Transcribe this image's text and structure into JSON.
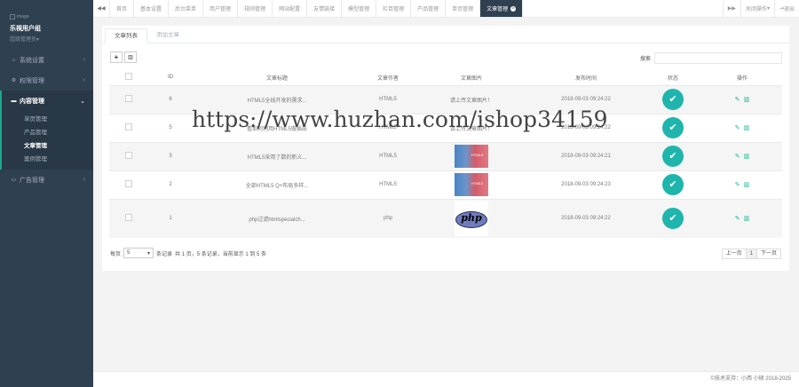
{
  "sidebar": {
    "avatar_alt": "image",
    "username": "乐視用户组",
    "role": "超级管理员",
    "role_caret": "▾",
    "nav": [
      {
        "label": "系统设置",
        "icon": "home-icon"
      },
      {
        "label": "权限管理",
        "icon": "gear-icon"
      },
      {
        "label": "内容管理",
        "icon": "folder-icon"
      },
      {
        "label": "广告管理",
        "icon": "monitor-icon"
      }
    ],
    "sub": [
      "单页管理",
      "产品管理",
      "文章管理",
      "案例管理"
    ]
  },
  "topbar": {
    "prev_arrow": "◀◀",
    "next_arrow": "▶▶",
    "tabs": [
      "首页",
      "基本设置",
      "后台菜单",
      "用户管理",
      "规则管理",
      "网站配置",
      "友情链接",
      "模型管理",
      "栏目管理",
      "产品管理",
      "单页管理",
      "文章管理"
    ],
    "close_ops": "关闭操作",
    "logout": "退出"
  },
  "panel": {
    "subtabs": [
      "文章列表",
      "添加文章"
    ],
    "add_btn": "+",
    "del_btn": "🗑",
    "search_label": "搜索",
    "search_value": "",
    "columns": [
      "",
      "ID",
      "文章标题",
      "文章作者",
      "文章图片",
      "发布时间",
      "状态",
      "操作"
    ],
    "rows": [
      {
        "id": "6",
        "title": "HTML5全线开发的需求...",
        "author": "HTML5",
        "image": "请上传文章图片！",
        "thumb": "text",
        "time": "2018-09-03 09:24:22"
      },
      {
        "id": "5",
        "title": "看如何利用HTML5做插出",
        "author": "HTML5",
        "image": "请上传文章图片！",
        "thumb": "text",
        "time": "2018-09-03 09:24:22"
      },
      {
        "id": "3",
        "title": "HTML5采用了数的新义...",
        "author": "HTML5",
        "image": "",
        "thumb": "html",
        "time": "2018-09-03 09:24:21"
      },
      {
        "id": "2",
        "title": "全部HTML5 Q+布局多样...",
        "author": "HTML5",
        "image": "",
        "thumb": "html",
        "time": "2018-09-03 09:24:23"
      },
      {
        "id": "1",
        "title": "php过滤htmlspecialch...",
        "author": "php",
        "image": "",
        "thumb": "php",
        "time": "2018-09-03 09:24:22"
      }
    ],
    "status_icon": "✔",
    "edit_icon": "✎",
    "delete_icon": "🗑",
    "per_page_label": "每页",
    "page_size": "5",
    "per_page_suffix": "条记录",
    "summary": "共 1 页，5 条记录，当前显示 1 到 5 条",
    "prev": "上一页",
    "current_page": "1",
    "next": "下一页"
  },
  "watermark": "https://www.huzhan.com/ishop34159",
  "footer": "©技术支持：小西 小硕 2018-2025",
  "php_logo_text": "php",
  "accent": "#19aa8d",
  "sidebar_bg": "#2f4050",
  "status_color": "#1fb5ad"
}
